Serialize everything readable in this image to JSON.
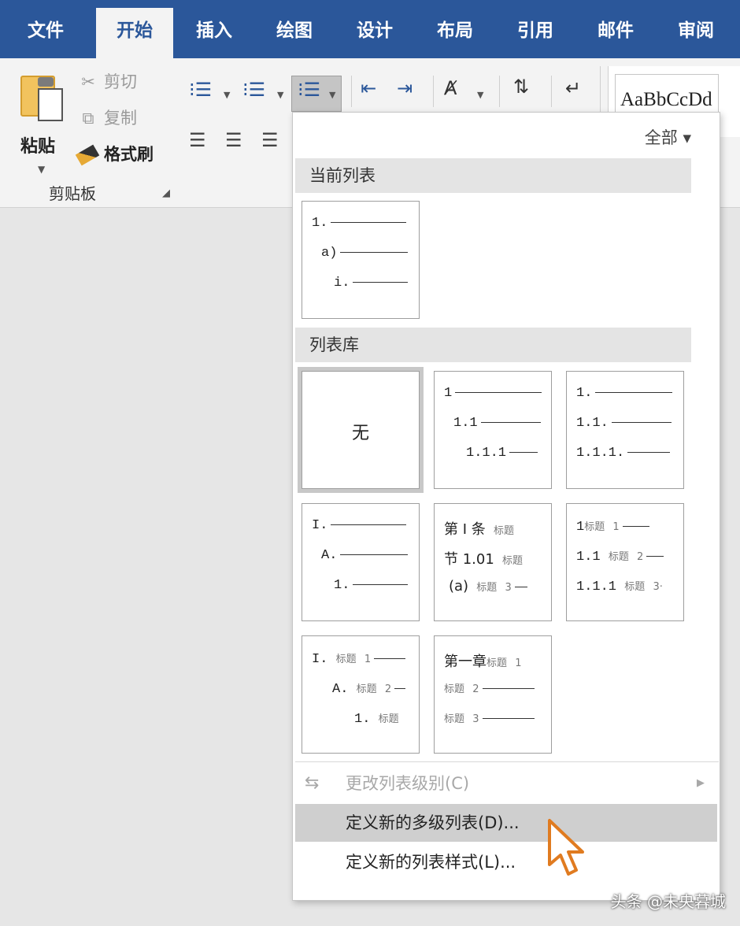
{
  "tabs": [
    "文件",
    "开始",
    "插入",
    "绘图",
    "设计",
    "布局",
    "引用",
    "邮件",
    "审阅"
  ],
  "active_tab_index": 1,
  "clipboard": {
    "paste_label": "粘贴",
    "cut_label": "剪切",
    "copy_label": "复制",
    "format_painter_label": "格式刷",
    "group_label": "剪贴板"
  },
  "styles": {
    "preview_text": "AaBbCcDd"
  },
  "dropdown": {
    "filter_label": "全部 ▾",
    "current_list_header": "当前列表",
    "library_header": "列表库",
    "none_label": "无",
    "current_list": [
      "1.",
      "a)",
      "i."
    ],
    "library": {
      "b": [
        "1",
        "1.1",
        "1.1.1"
      ],
      "c": [
        "1.",
        "1.1.",
        "1.1.1."
      ],
      "d": [
        "I.",
        "A.",
        "1."
      ],
      "e": [
        {
          "a": "第 Ⅰ 条",
          "b": "标题",
          "c": ""
        },
        {
          "a": "节 1.01",
          "b": "标题",
          "c": ""
        },
        {
          "a": "(a)",
          "b": "标题",
          "c": "3"
        }
      ],
      "f": [
        {
          "a": "1",
          "b": "标题",
          "c": "1"
        },
        {
          "a": "1.1",
          "b": "标题",
          "c": "2"
        },
        {
          "a": "1.1.1",
          "b": "标题",
          "c": "3·"
        }
      ],
      "g": [
        {
          "a": "I.",
          "b": "标题",
          "c": "1"
        },
        {
          "a": "A.",
          "b": "标题",
          "c": "2"
        },
        {
          "a": "1.",
          "b": "标题",
          "c": ""
        }
      ],
      "h": [
        {
          "a": "第一章",
          "b": "标题",
          "c": "1"
        },
        {
          "a": "",
          "b": "标题",
          "c": "2"
        },
        {
          "a": "",
          "b": "标题",
          "c": "3"
        }
      ]
    },
    "menu": {
      "change_level": "更改列表级别(C)",
      "define_multilevel": "定义新的多级列表(D)...",
      "define_style": "定义新的列表样式(L)..."
    }
  },
  "watermark": "头条 @未央暮城",
  "colors": {
    "ribbon_blue": "#2b579a",
    "hover_gray": "#cfcfcf",
    "cursor_orange": "#e07b20"
  }
}
